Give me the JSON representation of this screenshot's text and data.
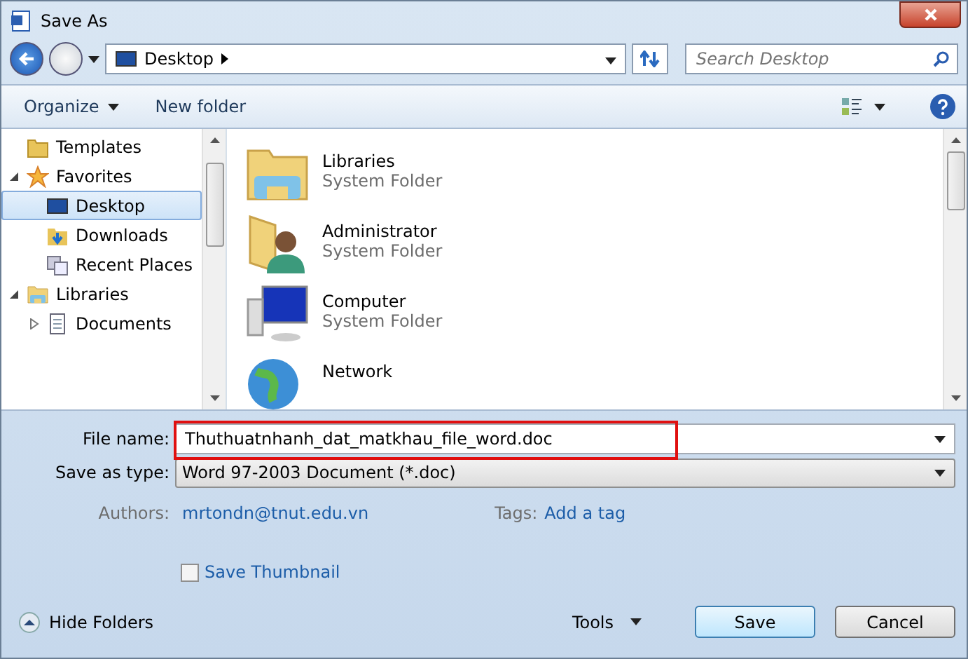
{
  "window": {
    "title": "Save As"
  },
  "address": {
    "location": "Desktop",
    "search_placeholder": "Search Desktop"
  },
  "toolbar": {
    "organize": "Organize",
    "new_folder": "New folder"
  },
  "nav": {
    "items": [
      {
        "label": "Templates",
        "kind": "folder",
        "selected": false
      },
      {
        "label": "Favorites",
        "kind": "star",
        "expanded": true,
        "selected": false,
        "children": [
          {
            "label": "Desktop",
            "kind": "desktop",
            "selected": true
          },
          {
            "label": "Downloads",
            "kind": "downloads",
            "selected": false
          },
          {
            "label": "Recent Places",
            "kind": "recent",
            "selected": false
          }
        ]
      },
      {
        "label": "Libraries",
        "kind": "libraries",
        "expanded": true,
        "selected": false,
        "children": [
          {
            "label": "Documents",
            "kind": "document",
            "expanded": false,
            "selected": false
          }
        ]
      }
    ]
  },
  "files": [
    {
      "name": "Libraries",
      "type": "System Folder",
      "kind": "libraries"
    },
    {
      "name": "Administrator",
      "type": "System Folder",
      "kind": "user"
    },
    {
      "name": "Computer",
      "type": "System Folder",
      "kind": "computer"
    },
    {
      "name": "Network",
      "kind": "network"
    }
  ],
  "form": {
    "file_name_label": "File name:",
    "file_name": "Thuthuatnhanh_dat_matkhau_file_word.doc",
    "type_label": "Save as type:",
    "type": "Word 97-2003 Document (*.doc)",
    "authors_label": "Authors:",
    "authors": "mrtondn@tnut.edu.vn",
    "tags_label": "Tags:",
    "tags": "Add a tag",
    "thumbnail_label": "Save Thumbnail",
    "thumbnail_checked": false
  },
  "buttons": {
    "hide_folders": "Hide Folders",
    "tools": "Tools",
    "save": "Save",
    "cancel": "Cancel"
  }
}
